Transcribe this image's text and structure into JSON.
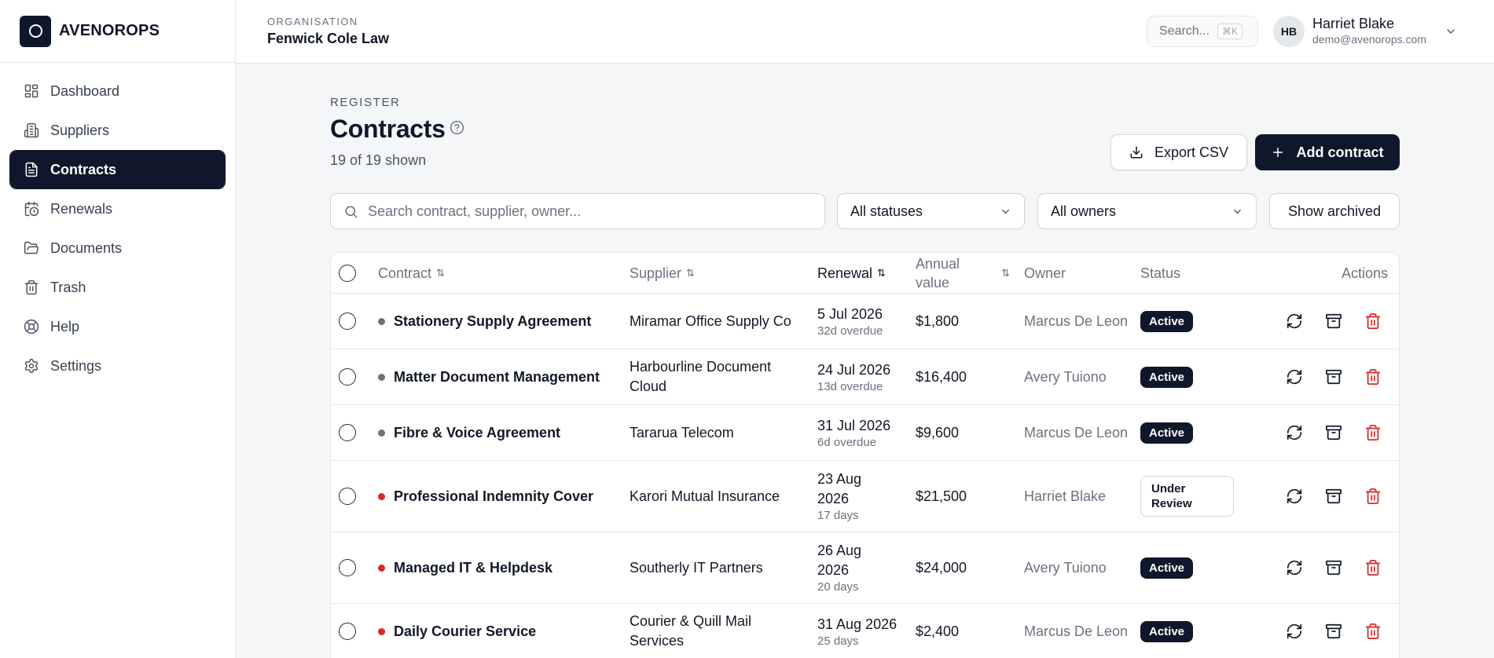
{
  "brand": {
    "name": "AVENOROPS"
  },
  "sidebar": {
    "items": [
      {
        "label": "Dashboard",
        "icon": "dashboard-icon"
      },
      {
        "label": "Suppliers",
        "icon": "building-icon"
      },
      {
        "label": "Contracts",
        "icon": "document-icon",
        "active": true
      },
      {
        "label": "Renewals",
        "icon": "calendar-clock-icon"
      },
      {
        "label": "Documents",
        "icon": "folder-icon"
      },
      {
        "label": "Trash",
        "icon": "trash-icon"
      },
      {
        "label": "Help",
        "icon": "lifebuoy-icon"
      },
      {
        "label": "Settings",
        "icon": "gear-icon"
      }
    ]
  },
  "header": {
    "org_label": "ORGANISATION",
    "org_name": "Fenwick Cole Law",
    "search_label": "Search...",
    "search_shortcut": "⌘K",
    "user": {
      "initials": "HB",
      "name": "Harriet Blake",
      "email": "demo@avenorops.com"
    }
  },
  "page": {
    "eyebrow": "REGISTER",
    "title": "Contracts",
    "count": "19 of 19 shown",
    "export_label": "Export CSV",
    "add_label": "Add contract"
  },
  "filters": {
    "search_placeholder": "Search contract, supplier, owner...",
    "status": "All statuses",
    "owner": "All owners",
    "archived_label": "Show archived"
  },
  "table": {
    "columns": {
      "contract": "Contract",
      "supplier": "Supplier",
      "renewal": "Renewal",
      "annual_line1": "Annual",
      "annual_line2": "value",
      "owner": "Owner",
      "status": "Status",
      "actions": "Actions"
    },
    "sort_glyph": "⇅",
    "rows": [
      {
        "contract": "Stationery Supply Agreement",
        "dot": "gray",
        "supplier": "Miramar Office Supply Co",
        "renewal": "5 Jul 2026",
        "renewal_sub": "32d overdue",
        "value": "$1,800",
        "owner": "Marcus De Leon",
        "status": "Active"
      },
      {
        "contract": "Matter Document Management",
        "dot": "gray",
        "supplier": "Harbourline Document Cloud",
        "renewal": "24 Jul 2026",
        "renewal_sub": "13d overdue",
        "value": "$16,400",
        "owner": "Avery Tuiono",
        "status": "Active"
      },
      {
        "contract": "Fibre & Voice Agreement",
        "dot": "gray",
        "supplier": "Tararua Telecom",
        "renewal": "31 Jul 2026",
        "renewal_sub": "6d overdue",
        "value": "$9,600",
        "owner": "Marcus De Leon",
        "status": "Active"
      },
      {
        "contract": "Professional Indemnity Cover",
        "dot": "red",
        "supplier": "Karori Mutual Insurance",
        "renewal": "23 Aug 2026",
        "renewal_sub": "17 days",
        "value": "$21,500",
        "owner": "Harriet Blake",
        "status": "Under Review"
      },
      {
        "contract": "Managed IT & Helpdesk",
        "dot": "red",
        "supplier": "Southerly IT Partners",
        "renewal": "26 Aug 2026",
        "renewal_sub": "20 days",
        "value": "$24,000",
        "owner": "Avery Tuiono",
        "status": "Active"
      },
      {
        "contract": "Daily Courier Service",
        "dot": "red",
        "supplier": "Courier & Quill Mail Services",
        "renewal": "31 Aug 2026",
        "renewal_sub": "25 days",
        "value": "$2,400",
        "owner": "Marcus De Leon",
        "status": "Active"
      }
    ]
  },
  "colors": {
    "primary": "#0f172a",
    "dot_gray": "#6b7280",
    "dot_red": "#dc2626",
    "delete": "#dc2626",
    "background": "#f5f6f8"
  }
}
